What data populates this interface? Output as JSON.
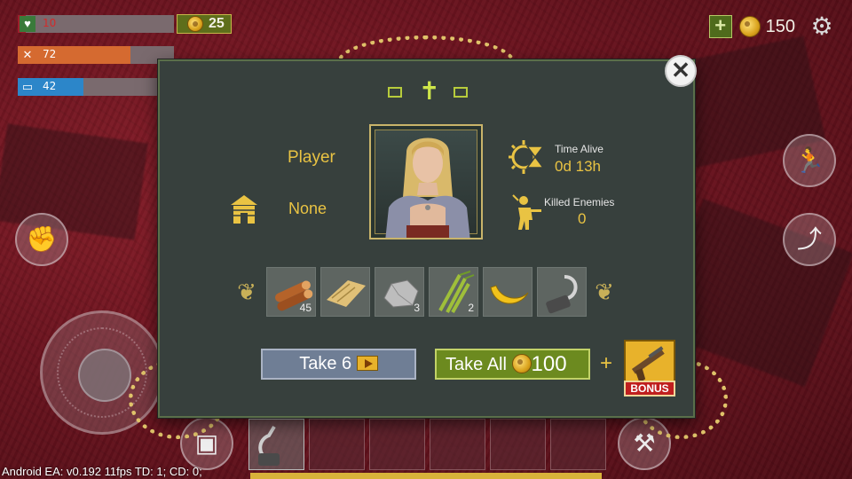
{
  "hud": {
    "health": {
      "value": "10",
      "fill": 0.05,
      "color": "#9c1f2b"
    },
    "hunger": {
      "value": "72",
      "fill": 0.72,
      "color": "#d56a30"
    },
    "thirst": {
      "value": "42",
      "fill": 0.42,
      "color": "#2c86c9"
    },
    "coins_small": "25",
    "gold": "150"
  },
  "death_screen": {
    "player_label": "Player",
    "house_value": "None",
    "time_alive_label": "Time Alive",
    "time_alive_value": "0d 13h",
    "killed_label": "Killed Enemies",
    "killed_value": "0",
    "items": [
      {
        "name": "logs",
        "icon": "logs-icon",
        "count": "45"
      },
      {
        "name": "cloth",
        "icon": "cloth-icon",
        "count": ""
      },
      {
        "name": "stone",
        "icon": "stone-icon",
        "count": "3"
      },
      {
        "name": "sugarcane",
        "icon": "sugarcane-icon",
        "count": "2"
      },
      {
        "name": "banana",
        "icon": "banana-icon",
        "count": ""
      },
      {
        "name": "hook",
        "icon": "hook-icon",
        "count": ""
      }
    ],
    "take_button": "Take 6",
    "take_all_button": "Take All",
    "take_all_price": "100",
    "plus": "+",
    "bonus_label": "BONUS"
  },
  "debug_text": "Android EA: v0.192 11fps TD: 1; CD: 0;",
  "colors": {
    "accent_gold": "#e9c343",
    "dialog_bg": "#37403d",
    "take_all": "#6c8a1f",
    "take": "#6f7e95"
  }
}
